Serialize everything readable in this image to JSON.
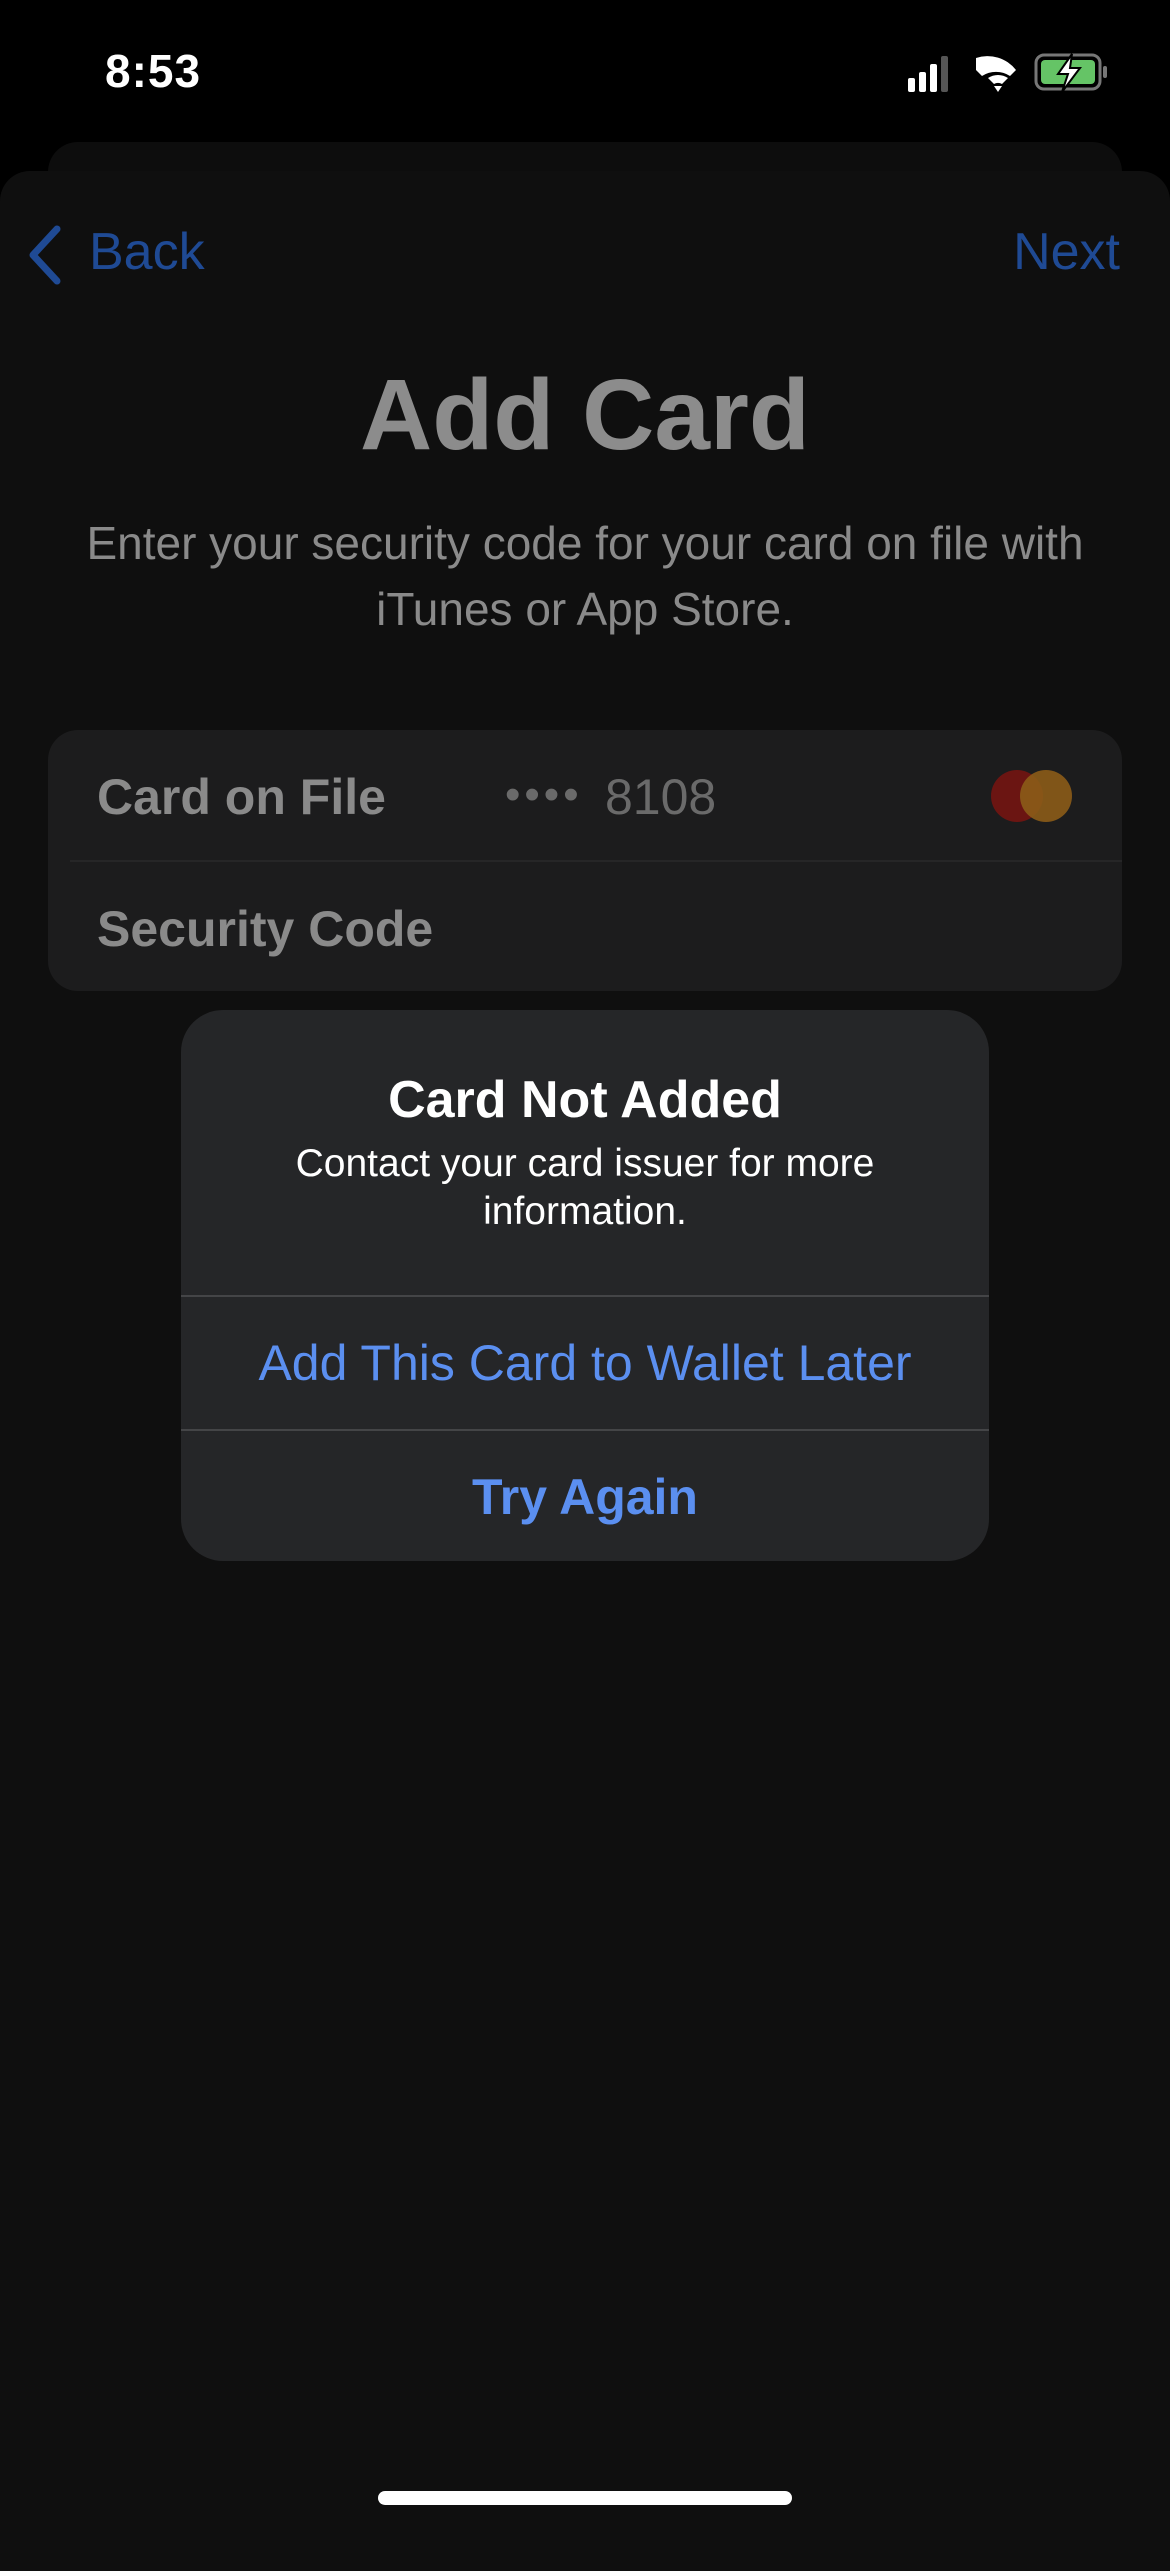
{
  "status_bar": {
    "time": "8:53",
    "icons": [
      "cellular-signal-icon",
      "wifi-icon",
      "battery-charging-icon"
    ],
    "battery_color": "#65c466"
  },
  "nav": {
    "back_label": "Back",
    "next_label": "Next",
    "accent_color": "#1f4a94"
  },
  "page": {
    "title": "Add Card",
    "subtitle": "Enter your security code for your card on file with iTunes or App Store."
  },
  "form": {
    "card_on_file_label": "Card on File",
    "card_dots": "••••",
    "card_last4": "8108",
    "card_brand_icon": "mastercard-icon",
    "security_code_label": "Security Code"
  },
  "alert": {
    "title": "Card Not Added",
    "message": "Contact your card issuer for more information.",
    "buttons": [
      "Add This Card to Wallet Later",
      "Try Again"
    ],
    "button_color": "#5b8ff0"
  }
}
